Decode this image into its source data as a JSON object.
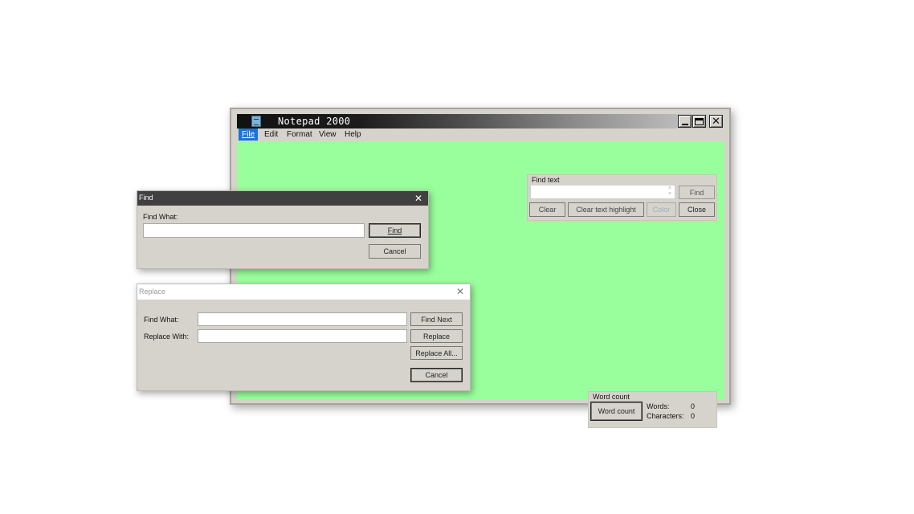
{
  "app": {
    "title": "Notepad 2000",
    "minimize_icon": "minimize-icon",
    "maximize_icon": "maximize-icon",
    "close_glyph": "✕",
    "editor_color": "#99ff9c"
  },
  "menu": {
    "items": [
      {
        "label": "File",
        "active": true
      },
      {
        "label": "Edit"
      },
      {
        "label": "Format"
      },
      {
        "label": "View"
      },
      {
        "label": "Help"
      }
    ]
  },
  "find_panel": {
    "label": "Find text",
    "input_value": "",
    "spin_up": "˄",
    "spin_down": "˅",
    "find_label": "Find",
    "clear_label": "Clear",
    "clear_highlight_label": "Clear text highlight",
    "color_label": "Color",
    "close_label": "Close"
  },
  "word_count": {
    "label": "Word count",
    "button_label": "Word count",
    "words_label": "Words:",
    "words_value": "0",
    "characters_label": "Characters:",
    "characters_value": "0"
  },
  "find_dialog": {
    "title": "Find",
    "close_glyph": "✕",
    "find_what_label": "Find What:",
    "find_what_value": "",
    "find_button": "Find",
    "cancel_button": "Cancel"
  },
  "replace_dialog": {
    "title": "Replace",
    "close_glyph": "✕",
    "find_what_label": "Find What:",
    "find_what_value": "",
    "replace_with_label": "Replace With:",
    "replace_with_value": "",
    "find_next_button": "Find Next",
    "replace_button": "Replace",
    "replace_all_button": "Replace All...",
    "cancel_button": "Cancel"
  }
}
